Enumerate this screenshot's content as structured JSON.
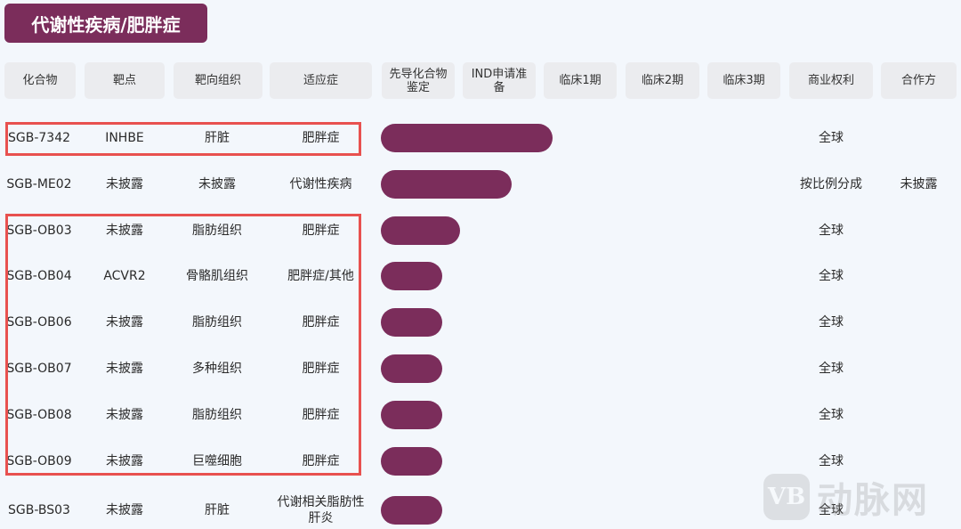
{
  "title": "代谢性疾病/肥胖症",
  "headers": [
    "化合物",
    "靶点",
    "靶向组织",
    "适应症",
    "先导化合物鉴定",
    "IND申请准备",
    "临床1期",
    "临床2期",
    "临床3期",
    "商业权利",
    "合作方"
  ],
  "rows": [
    {
      "compound": "SGB-7342",
      "target": "INHBE",
      "tissue": "肝脏",
      "indication": "肥胖症",
      "rights": "全球",
      "partner": "",
      "progress_end_col": 5
    },
    {
      "compound": "SGB-ME02",
      "target": "未披露",
      "tissue": "未披露",
      "indication": "代谢性疾病",
      "rights": "按比例分成",
      "partner": "未披露",
      "progress_end_col": 5
    },
    {
      "compound": "SGB-OB03",
      "target": "未披露",
      "tissue": "脂肪组织",
      "indication": "肥胖症",
      "rights": "全球",
      "partner": "",
      "progress_end_col": 4
    },
    {
      "compound": "SGB-OB04",
      "target": "ACVR2",
      "tissue": "骨骼肌组织",
      "indication": "肥胖症/其他",
      "rights": "全球",
      "partner": "",
      "progress_end_col": 4
    },
    {
      "compound": "SGB-OB06",
      "target": "未披露",
      "tissue": "脂肪组织",
      "indication": "肥胖症",
      "rights": "全球",
      "partner": "",
      "progress_end_col": 4
    },
    {
      "compound": "SGB-OB07",
      "target": "未披露",
      "tissue": "多种组织",
      "indication": "肥胖症",
      "rights": "全球",
      "partner": "",
      "progress_end_col": 4
    },
    {
      "compound": "SGB-OB08",
      "target": "未披露",
      "tissue": "脂肪组织",
      "indication": "肥胖症",
      "rights": "全球",
      "partner": "",
      "progress_end_col": 4
    },
    {
      "compound": "SGB-OB09",
      "target": "未披露",
      "tissue": "巨噬细胞",
      "indication": "肥胖症",
      "rights": "全球",
      "partner": "",
      "progress_end_col": 4
    },
    {
      "compound": "SGB-BS03",
      "target": "未披露",
      "tissue": "肝脏",
      "indication": "代谢相关脂肪性肝炎",
      "rights": "全球",
      "partner": "",
      "progress_end_col": 4
    }
  ],
  "progress": [
    0.5,
    0.38,
    0.23,
    0.18,
    0.18,
    0.18,
    0.18,
    0.18,
    0.18
  ],
  "watermark": {
    "icon": "VB",
    "text": "动脉网"
  },
  "colors": {
    "accent": "#7b2d5b",
    "highlight": "#e8514f",
    "header_bg": "#ebecef",
    "background": "#f3f7fc"
  }
}
